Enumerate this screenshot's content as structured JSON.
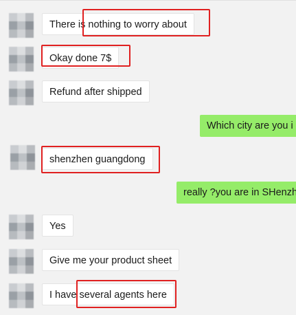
{
  "chat": {
    "messages": [
      {
        "side": "left",
        "text": "There is nothing to worry about",
        "highlighted": true
      },
      {
        "side": "left",
        "text": "Okay done 7$",
        "highlighted": true
      },
      {
        "side": "left",
        "text": "Refund after shipped",
        "highlighted": false
      },
      {
        "side": "right",
        "text": "Which city are you i",
        "highlighted": false
      },
      {
        "side": "left",
        "text": "shenzhen guangdong",
        "highlighted": true
      },
      {
        "side": "right",
        "text": "really ?you are in SHenzh",
        "highlighted": false
      },
      {
        "side": "left",
        "text": "Yes",
        "highlighted": false
      },
      {
        "side": "left",
        "text": "Give me your product sheet",
        "highlighted": false
      },
      {
        "side": "left",
        "text": "I have several agents here",
        "highlighted": true
      }
    ]
  },
  "colors": {
    "background": "#f2f2f2",
    "incoming_bubble": "#ffffff",
    "outgoing_bubble": "#95ec69",
    "highlight_box": "#e02020"
  },
  "icons": {
    "avatar": "blurred-avatar-icon"
  }
}
